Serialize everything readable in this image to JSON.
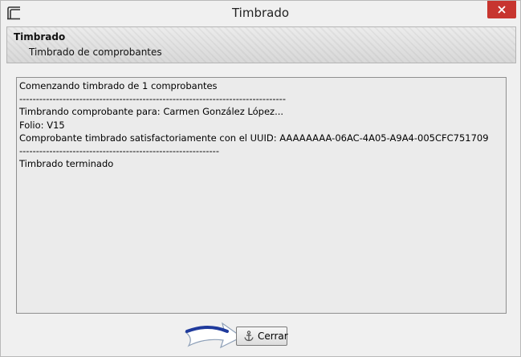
{
  "window": {
    "title": "Timbrado"
  },
  "header": {
    "title": "Timbrado",
    "subtitle": "Timbrado de comprobantes"
  },
  "log": {
    "lines": [
      "Comenzando timbrado de 1 comprobantes",
      "--------------------------------------------------------------------------------",
      "Timbrando comprobante para: Carmen González López...",
      "Folio: V15",
      "Comprobante timbrado satisfactoriamente con el UUID: AAAAAAAA-06AC-4A05-A9A4-005CFC751709",
      "------------------------------------------------------------",
      "Timbrado terminado"
    ]
  },
  "actions": {
    "close_label": "Cerrar"
  },
  "icons": {
    "app": "window-icon",
    "close": "close-icon",
    "button": "anchor-icon",
    "pointer": "arrow-icon"
  },
  "colors": {
    "close_button": "#c7352f",
    "arrow": "#1f3a9c"
  }
}
